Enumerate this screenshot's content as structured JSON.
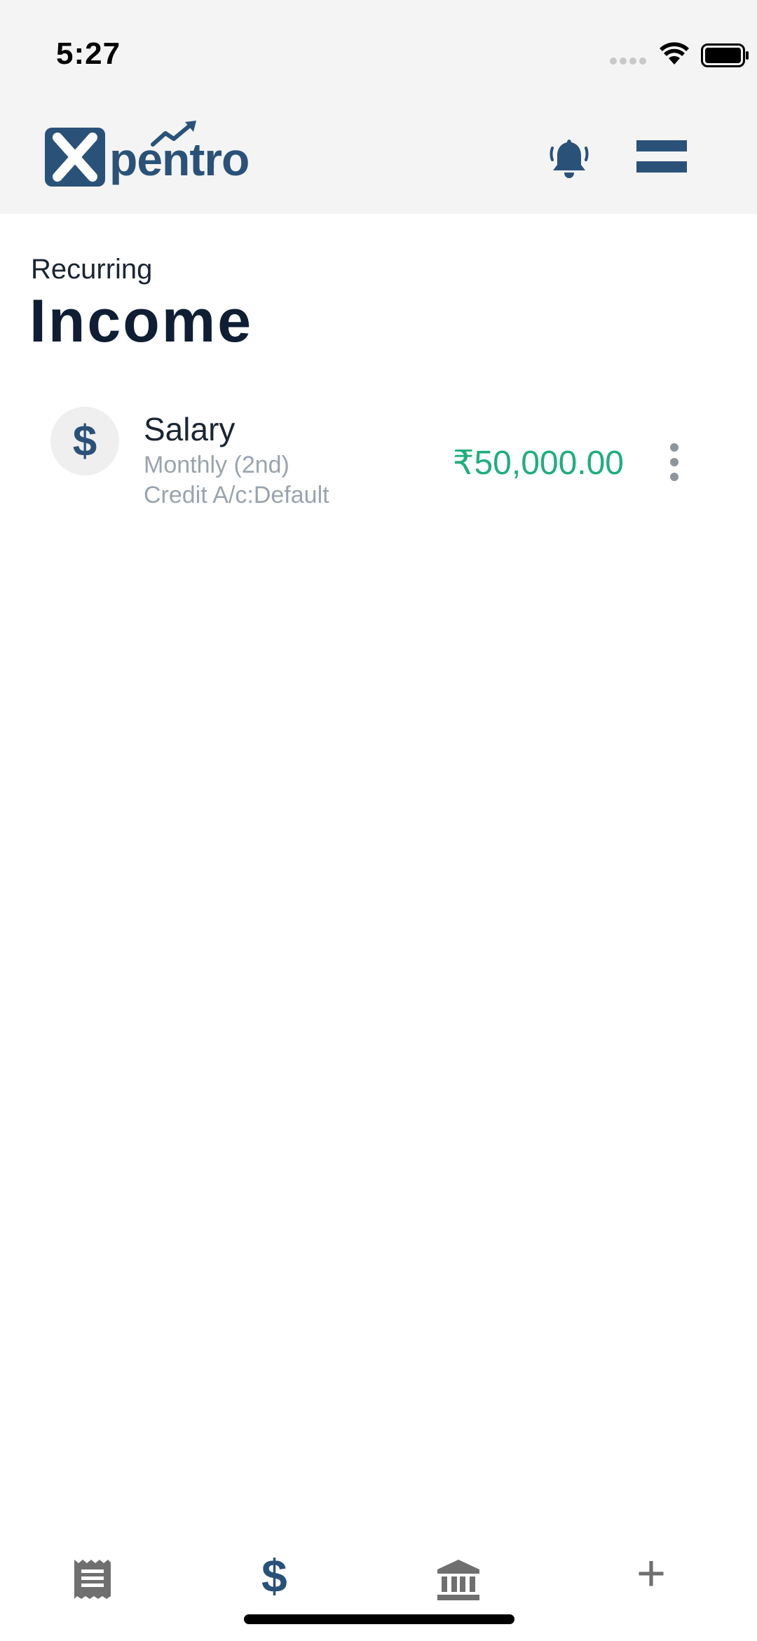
{
  "status": {
    "time": "5:27"
  },
  "header": {
    "logo_text": "pentro",
    "logo_letter": "X",
    "bell_icon": "bell-icon",
    "menu_icon": "menu-icon"
  },
  "page": {
    "subtitle": "Recurring",
    "title": "Income"
  },
  "items": [
    {
      "icon": "$",
      "name": "Salary",
      "frequency": "Monthly (2nd)",
      "account": "Credit A/c:Default",
      "amount": "₹50,000.00"
    }
  ],
  "tabs": [
    {
      "icon": "receipt-icon",
      "active": false
    },
    {
      "icon": "dollar-icon",
      "label": "$",
      "active": true
    },
    {
      "icon": "bank-icon",
      "active": false
    },
    {
      "icon": "plus-icon",
      "label": "+",
      "active": false
    }
  ],
  "colors": {
    "brand": "#2a5279",
    "amount": "#1fae7c",
    "muted": "#9aa4ae",
    "tab_inactive": "#6f6f6f"
  }
}
